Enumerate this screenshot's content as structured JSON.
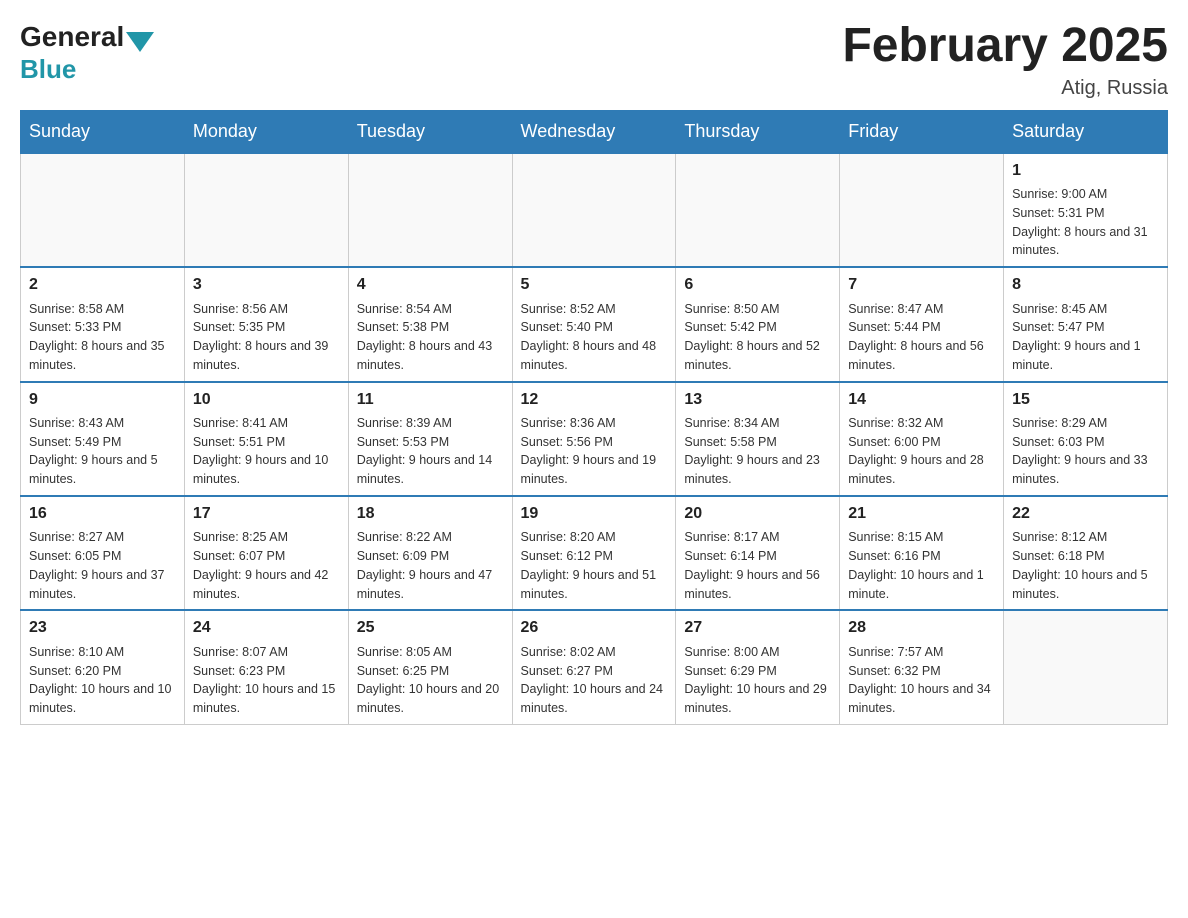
{
  "header": {
    "logo_text_general": "General",
    "logo_text_blue": "Blue",
    "month_year": "February 2025",
    "location": "Atig, Russia"
  },
  "days_of_week": [
    "Sunday",
    "Monday",
    "Tuesday",
    "Wednesday",
    "Thursday",
    "Friday",
    "Saturday"
  ],
  "weeks": [
    [
      {
        "day": "",
        "info": ""
      },
      {
        "day": "",
        "info": ""
      },
      {
        "day": "",
        "info": ""
      },
      {
        "day": "",
        "info": ""
      },
      {
        "day": "",
        "info": ""
      },
      {
        "day": "",
        "info": ""
      },
      {
        "day": "1",
        "info": "Sunrise: 9:00 AM\nSunset: 5:31 PM\nDaylight: 8 hours and 31 minutes."
      }
    ],
    [
      {
        "day": "2",
        "info": "Sunrise: 8:58 AM\nSunset: 5:33 PM\nDaylight: 8 hours and 35 minutes."
      },
      {
        "day": "3",
        "info": "Sunrise: 8:56 AM\nSunset: 5:35 PM\nDaylight: 8 hours and 39 minutes."
      },
      {
        "day": "4",
        "info": "Sunrise: 8:54 AM\nSunset: 5:38 PM\nDaylight: 8 hours and 43 minutes."
      },
      {
        "day": "5",
        "info": "Sunrise: 8:52 AM\nSunset: 5:40 PM\nDaylight: 8 hours and 48 minutes."
      },
      {
        "day": "6",
        "info": "Sunrise: 8:50 AM\nSunset: 5:42 PM\nDaylight: 8 hours and 52 minutes."
      },
      {
        "day": "7",
        "info": "Sunrise: 8:47 AM\nSunset: 5:44 PM\nDaylight: 8 hours and 56 minutes."
      },
      {
        "day": "8",
        "info": "Sunrise: 8:45 AM\nSunset: 5:47 PM\nDaylight: 9 hours and 1 minute."
      }
    ],
    [
      {
        "day": "9",
        "info": "Sunrise: 8:43 AM\nSunset: 5:49 PM\nDaylight: 9 hours and 5 minutes."
      },
      {
        "day": "10",
        "info": "Sunrise: 8:41 AM\nSunset: 5:51 PM\nDaylight: 9 hours and 10 minutes."
      },
      {
        "day": "11",
        "info": "Sunrise: 8:39 AM\nSunset: 5:53 PM\nDaylight: 9 hours and 14 minutes."
      },
      {
        "day": "12",
        "info": "Sunrise: 8:36 AM\nSunset: 5:56 PM\nDaylight: 9 hours and 19 minutes."
      },
      {
        "day": "13",
        "info": "Sunrise: 8:34 AM\nSunset: 5:58 PM\nDaylight: 9 hours and 23 minutes."
      },
      {
        "day": "14",
        "info": "Sunrise: 8:32 AM\nSunset: 6:00 PM\nDaylight: 9 hours and 28 minutes."
      },
      {
        "day": "15",
        "info": "Sunrise: 8:29 AM\nSunset: 6:03 PM\nDaylight: 9 hours and 33 minutes."
      }
    ],
    [
      {
        "day": "16",
        "info": "Sunrise: 8:27 AM\nSunset: 6:05 PM\nDaylight: 9 hours and 37 minutes."
      },
      {
        "day": "17",
        "info": "Sunrise: 8:25 AM\nSunset: 6:07 PM\nDaylight: 9 hours and 42 minutes."
      },
      {
        "day": "18",
        "info": "Sunrise: 8:22 AM\nSunset: 6:09 PM\nDaylight: 9 hours and 47 minutes."
      },
      {
        "day": "19",
        "info": "Sunrise: 8:20 AM\nSunset: 6:12 PM\nDaylight: 9 hours and 51 minutes."
      },
      {
        "day": "20",
        "info": "Sunrise: 8:17 AM\nSunset: 6:14 PM\nDaylight: 9 hours and 56 minutes."
      },
      {
        "day": "21",
        "info": "Sunrise: 8:15 AM\nSunset: 6:16 PM\nDaylight: 10 hours and 1 minute."
      },
      {
        "day": "22",
        "info": "Sunrise: 8:12 AM\nSunset: 6:18 PM\nDaylight: 10 hours and 5 minutes."
      }
    ],
    [
      {
        "day": "23",
        "info": "Sunrise: 8:10 AM\nSunset: 6:20 PM\nDaylight: 10 hours and 10 minutes."
      },
      {
        "day": "24",
        "info": "Sunrise: 8:07 AM\nSunset: 6:23 PM\nDaylight: 10 hours and 15 minutes."
      },
      {
        "day": "25",
        "info": "Sunrise: 8:05 AM\nSunset: 6:25 PM\nDaylight: 10 hours and 20 minutes."
      },
      {
        "day": "26",
        "info": "Sunrise: 8:02 AM\nSunset: 6:27 PM\nDaylight: 10 hours and 24 minutes."
      },
      {
        "day": "27",
        "info": "Sunrise: 8:00 AM\nSunset: 6:29 PM\nDaylight: 10 hours and 29 minutes."
      },
      {
        "day": "28",
        "info": "Sunrise: 7:57 AM\nSunset: 6:32 PM\nDaylight: 10 hours and 34 minutes."
      },
      {
        "day": "",
        "info": ""
      }
    ]
  ]
}
